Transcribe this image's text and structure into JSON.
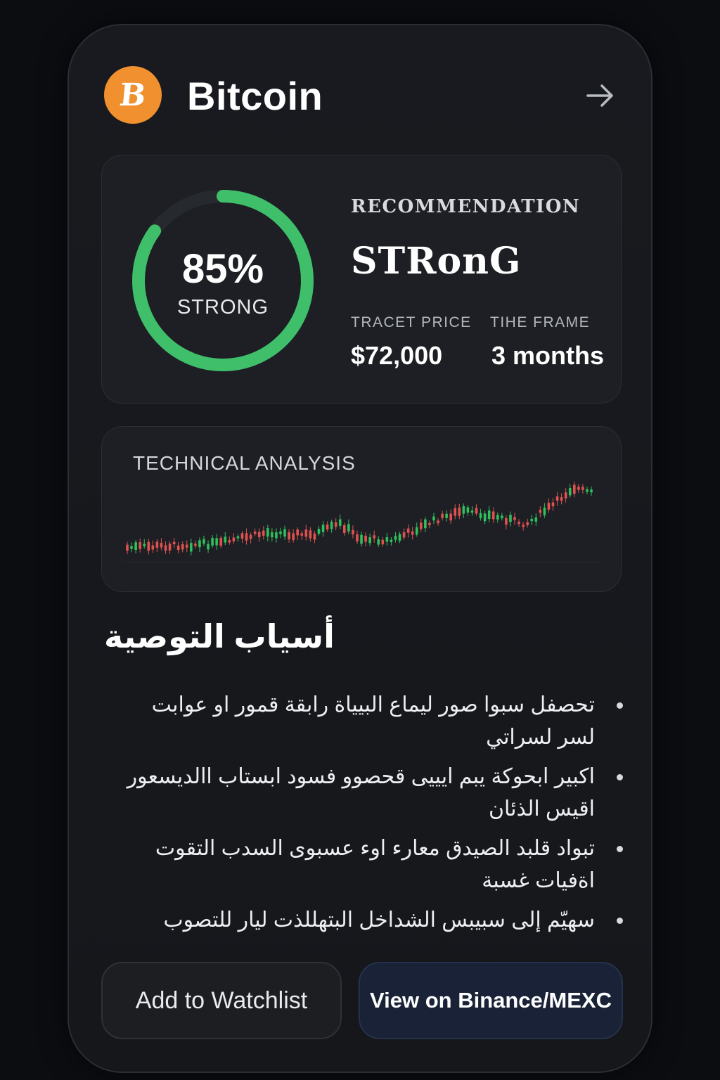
{
  "coin": {
    "name": "Bitcoin",
    "logo_glyph": "B",
    "logo_color": "#f0902f",
    "nav_icon": "arrow-right-icon"
  },
  "recommendation": {
    "score_text": "85%",
    "score_fraction": 0.85,
    "score_label": "STRONG",
    "title": "RECOMMENDATION",
    "value": "STRonG",
    "accent_color": "#3fbf6a",
    "target_price_label": "TRACET PRICE",
    "target_price_value": "$72,000",
    "time_frame_label": "TΙΗΕ FRAME",
    "time_frame_value": "3 months"
  },
  "technical_analysis": {
    "title": "TECHNICAL ANALYSIS",
    "up_color": "#2fbf5b",
    "down_color": "#e0524f"
  },
  "reasons": {
    "title": "أسياب التوصية",
    "items": [
      "تحصفل سبوا صور ليماع البيياة رابقة قمور او عوابت لسر لسراتي",
      "اكبير ابحوكة يبم ايييى قحصوو فسود ابستاب االديسعور اقيس الذئان",
      "تبواد قلبد الصيدق معارء اوء عسبوى السدب التقوت اةفيات غسبة",
      "سهيّم إلى سبيبس الشداخل البتهللذت ليار للتصوب"
    ]
  },
  "buttons": {
    "watchlist": "Add to Watchlist",
    "exchange": "View on Binance/MEXC"
  }
}
